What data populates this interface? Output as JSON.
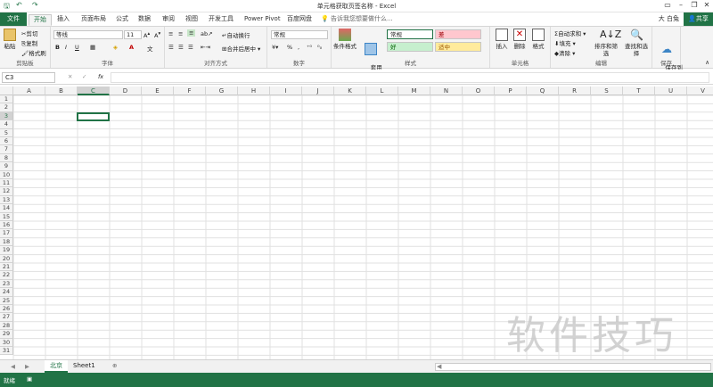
{
  "window": {
    "title": "单元格获取页签名称 - Excel",
    "user": "大 白兔",
    "share_label": "共享"
  },
  "tabs": [
    "文件",
    "开始",
    "插入",
    "页面布局",
    "公式",
    "数据",
    "审阅",
    "视图",
    "开发工具",
    "Power Pivot",
    "百度网盘"
  ],
  "tell_me": "告诉我您想要做什么...",
  "ribbon": {
    "clipboard": {
      "label": "剪贴板",
      "paste": "粘贴",
      "cut": "剪切",
      "copy": "复制",
      "format_painter": "格式刷"
    },
    "font": {
      "label": "字体",
      "font_name": "等线",
      "font_size": "11",
      "bold": "B",
      "italic": "I",
      "underline": "U",
      "font_color": "A"
    },
    "alignment": {
      "label": "对齐方式",
      "wrap": "自动换行",
      "merge": "合并后居中"
    },
    "number": {
      "label": "数字",
      "format": "常规",
      "percent": "%"
    },
    "styles": {
      "label": "样式",
      "conditional": "条件格式",
      "table": "套用\n表格格式",
      "normal": "常规",
      "bad": "差",
      "good": "好",
      "neutral": "适中"
    },
    "cells": {
      "label": "单元格",
      "insert": "插入",
      "delete": "删除",
      "format": "格式"
    },
    "editing": {
      "label": "编辑",
      "autosum": "自动求和",
      "fill": "填充",
      "clear": "清除",
      "sort": "排序和筛选",
      "find": "查找和选择"
    },
    "save": {
      "label": "保存",
      "save_btn": "保存到\n百度网盘"
    }
  },
  "formula_bar": {
    "name_box": "C3",
    "fx": "fx"
  },
  "columns": [
    "A",
    "B",
    "C",
    "D",
    "E",
    "F",
    "G",
    "H",
    "I",
    "J",
    "K",
    "L",
    "M",
    "N",
    "O",
    "P",
    "Q",
    "R",
    "S",
    "T",
    "U",
    "V"
  ],
  "rows": [
    "1",
    "2",
    "3",
    "4",
    "5",
    "6",
    "7",
    "8",
    "9",
    "10",
    "11",
    "12",
    "13",
    "14",
    "15",
    "16",
    "17",
    "18",
    "19",
    "20",
    "21",
    "22",
    "23",
    "24",
    "25",
    "26",
    "27",
    "28",
    "29",
    "30",
    "31"
  ],
  "sheets": [
    "北京",
    "Sheet1"
  ],
  "status": "就绪",
  "watermark": "软件技巧",
  "colors": {
    "accent": "#217346",
    "bad_bg": "#ffc7ce",
    "good_bg": "#c6efce",
    "neutral_bg": "#ffeb9c"
  }
}
